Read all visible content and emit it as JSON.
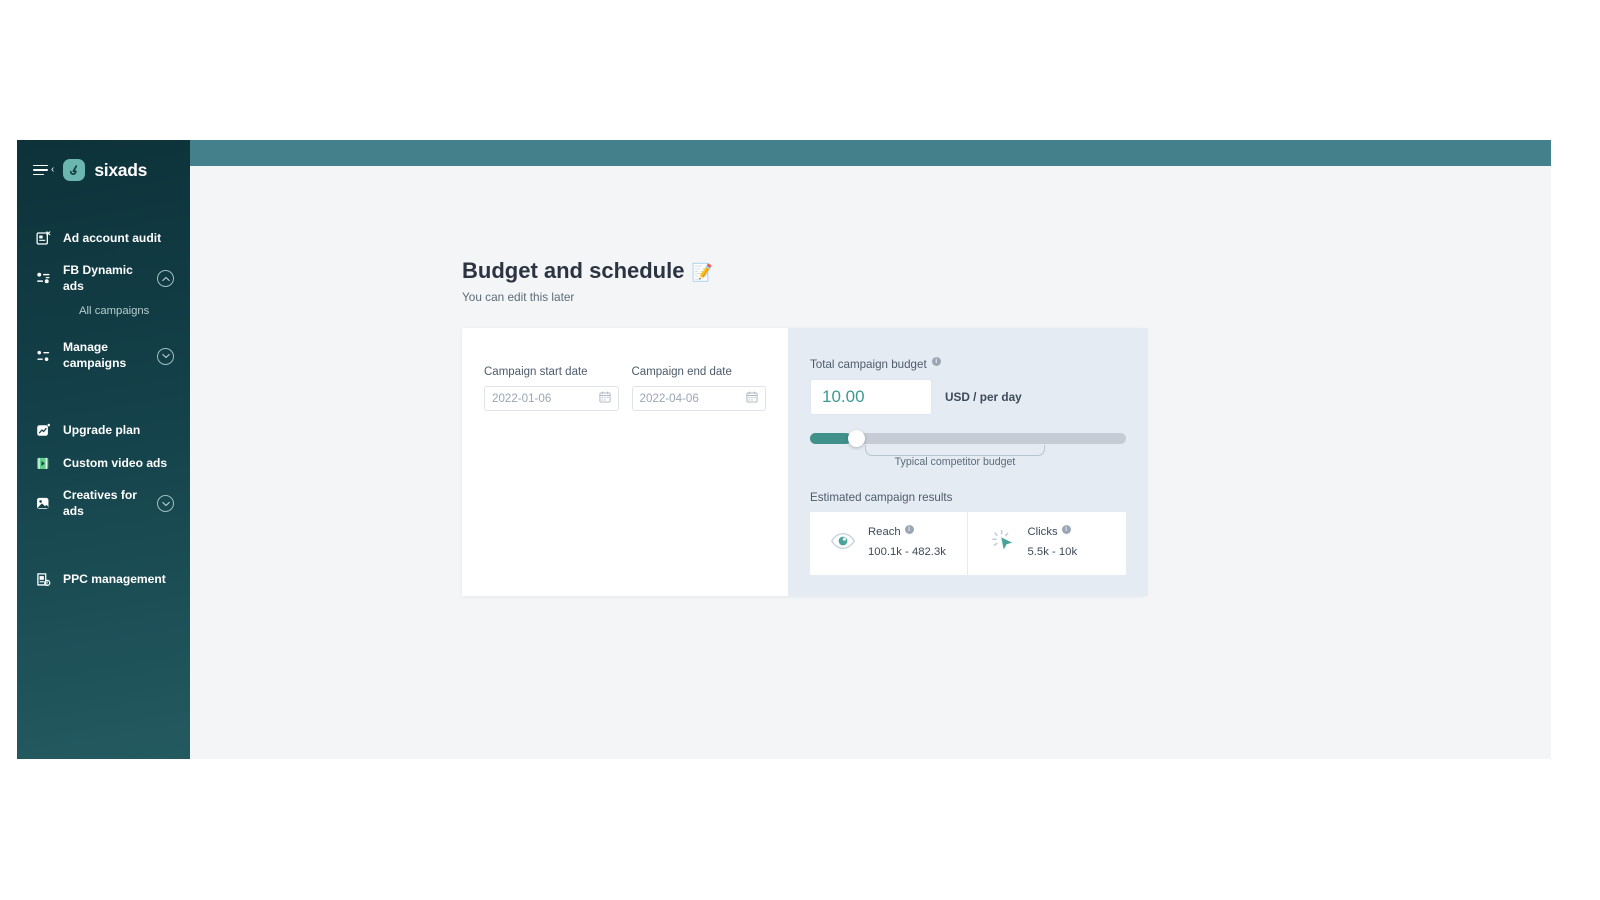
{
  "app": {
    "brand_name": "sixads",
    "logo_icon": "sixads-logo-mark",
    "menu_icon": "hamburger-collapse-icon"
  },
  "sidebar": {
    "items": [
      {
        "label": "Ad account audit",
        "icon": "ad-audit-icon",
        "chevron": null
      },
      {
        "label": "FB Dynamic ads",
        "icon": "fb-dynamic-ads-icon",
        "chevron": "chevron-up-icon"
      },
      {
        "label": "All campaigns",
        "icon": null,
        "chevron": null
      },
      {
        "label": "Manage campaigns",
        "icon": "manage-campaigns-icon",
        "chevron": "chevron-down-icon"
      },
      {
        "label": "Upgrade plan",
        "icon": "upgrade-plan-icon",
        "chevron": null
      },
      {
        "label": "Custom video ads",
        "icon": "custom-video-ads-icon",
        "chevron": null
      },
      {
        "label": "Creatives for ads",
        "icon": "creatives-for-ads-icon",
        "chevron": "chevron-down-icon"
      },
      {
        "label": "PPC management",
        "icon": "ppc-management-icon",
        "chevron": null
      }
    ],
    "manage_line1": "Manage",
    "manage_line2": "campaigns"
  },
  "page": {
    "title": "Budget and schedule",
    "title_emoji": "📝",
    "subtitle": "You can edit this later"
  },
  "schedule": {
    "start_label": "Campaign start date",
    "start_value": "2022-01-06",
    "start_placeholder": "2022-01-06",
    "end_label": "Campaign end date",
    "end_value": "2022-04-06",
    "end_placeholder": "2022-04-06",
    "calendar_icon": "calendar-icon"
  },
  "budget": {
    "label": "Total campaign budget",
    "info_icon": "info-icon",
    "value": "10.00",
    "placeholder": "10.00",
    "unit": "USD / per day",
    "slider": {
      "fill_percent": 13,
      "thumb_percent": 12,
      "brace_label": "Typical competitor budget"
    }
  },
  "results": {
    "title": "Estimated campaign results",
    "cards": [
      {
        "name": "Reach",
        "value": "100.1k - 482.3k",
        "icon": "eye-icon",
        "info_icon": "info-icon"
      },
      {
        "name": "Clicks",
        "value": "5.5k - 10k",
        "icon": "click-cursor-icon",
        "info_icon": "info-icon"
      }
    ]
  },
  "colors": {
    "accent_teal": "#3f9189",
    "topbar": "#44808c",
    "sidebar_dark": "#0d3239",
    "page_bg": "#f3f5f7",
    "panel_bg": "#e5ebf2"
  }
}
